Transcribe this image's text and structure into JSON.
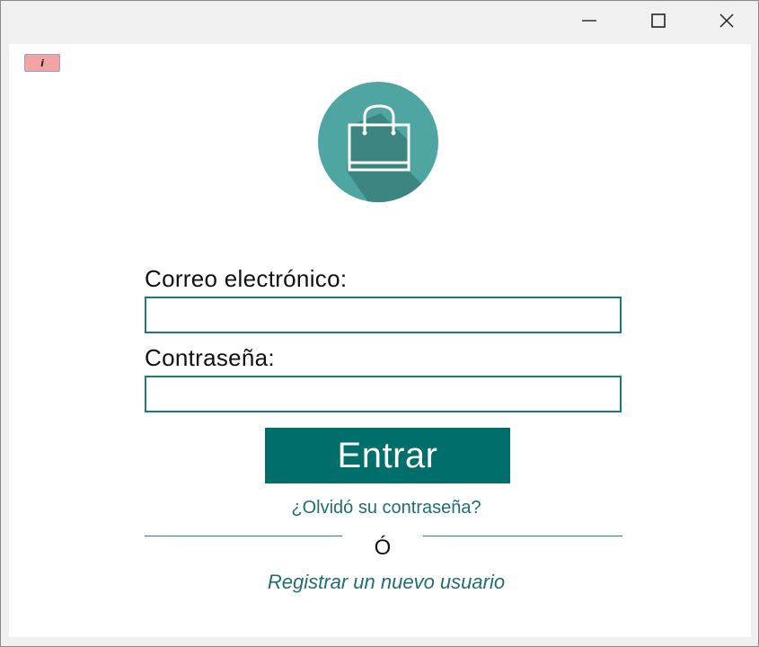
{
  "window": {
    "minimize_icon": "minimize-icon",
    "maximize_icon": "maximize-icon",
    "close_icon": "close-icon"
  },
  "info_badge": {
    "label": "i"
  },
  "logo": {
    "icon": "shopping-bag-icon",
    "circle_color": "#4ea5a2",
    "shadow_color": "#3a7f7b"
  },
  "form": {
    "email_label": "Correo electrónico:",
    "email_value": "",
    "password_label": "Contraseña:",
    "password_value": "",
    "submit_label": "Entrar",
    "forgot_link": "¿Olvidó su contraseña?",
    "or_text": "Ó",
    "register_link": "Registrar un nuevo usuario"
  },
  "colors": {
    "accent": "#006e6a",
    "link": "#1f6e75",
    "field_border": "#1d7a7a"
  }
}
